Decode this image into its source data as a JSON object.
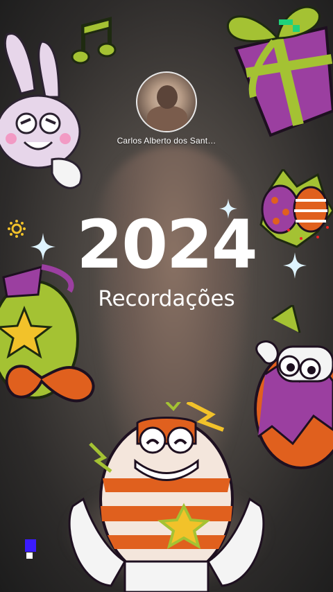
{
  "profile": {
    "name": "Carlos Alberto dos Sant…"
  },
  "recap": {
    "year": "2024",
    "title": "Recordações"
  },
  "theme": {
    "accent_green": "#1fd27b",
    "gift_purple": "#9b3fa0",
    "ribbon_green": "#a4c233",
    "egg_orange": "#e0601e"
  },
  "stickers": [
    "bunny-sticker",
    "music-note-sticker",
    "gift-box-sticker",
    "eggs-sticker",
    "star-egg-sticker",
    "peeking-egg-sticker",
    "smiling-egg-sticker",
    "sparkle-icon",
    "sun-icon",
    "lightning-icon"
  ]
}
